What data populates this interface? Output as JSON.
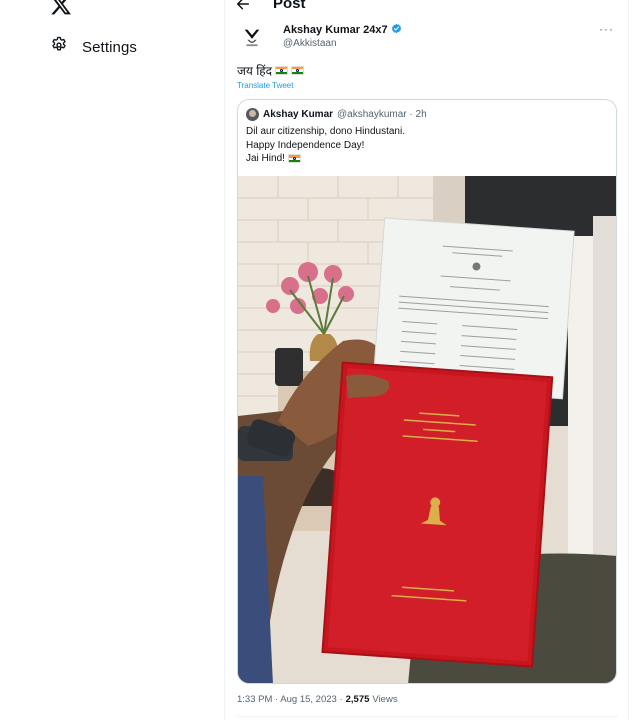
{
  "nav": {
    "logo_icon": "x-logo-icon",
    "settings_label": "Settings",
    "settings_icon": "gear-icon"
  },
  "header": {
    "title": "Post",
    "back_icon": "arrow-left-icon"
  },
  "tweet": {
    "author_name": "Akshay Kumar 24x7",
    "author_handle": "@Akkistaan",
    "verified_icon": "verified-badge-icon",
    "more_icon": "more-icon",
    "text": "जय हिंद",
    "translate_label": "Translate Tweet",
    "time": "1:33 PM · Aug 15, 2023 ·",
    "views_count": "2,575",
    "views_label": "Views"
  },
  "quote": {
    "author_name": "Akshay Kumar",
    "author_handle": "@akshaykumar · 2h",
    "line1": "Dil aur citizenship, dono Hindustani.",
    "line2": "Happy Independence Day!",
    "line3": "Jai Hind!"
  },
  "colors": {
    "accent": "#1d9bf0",
    "text": "#0f1419",
    "muted": "#536471",
    "border": "#cfd9de",
    "passport_red": "#d21e28"
  }
}
